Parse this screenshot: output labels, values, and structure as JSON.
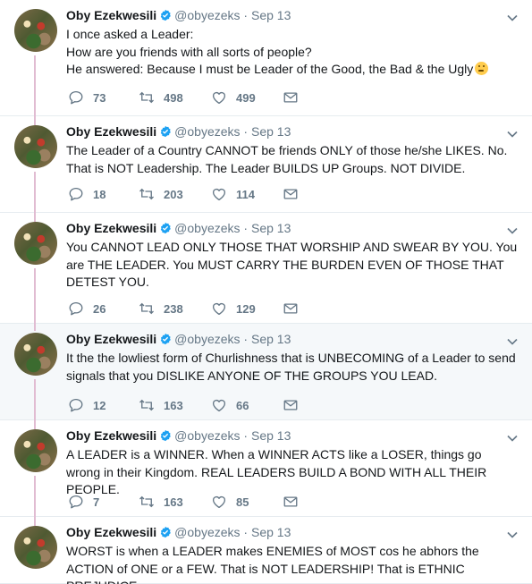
{
  "colors": {
    "verified": "#1da1f2",
    "secondary_text": "#657786",
    "thread_line": "#e1bcd2",
    "highlight_bg": "#f5f8fa"
  },
  "author": {
    "name": "Oby Ezekwesili",
    "handle": "@obyezeks",
    "separator": "·"
  },
  "tweets": [
    {
      "date": "Sep 13",
      "text": "I once asked a Leader:\nHow are you friends with all sorts of people?\nHe answered: Because I must be Leader of the Good, the Bad & the Ugly",
      "emoji": "thinking-face",
      "replies": "73",
      "retweets": "498",
      "likes": "499"
    },
    {
      "date": "Sep 13",
      "text": "The Leader of a Country CANNOT be friends ONLY of those he/she LIKES. No. That is NOT Leadership. The Leader BUILDS UP Groups. NOT DIVIDE.",
      "replies": "18",
      "retweets": "203",
      "likes": "114"
    },
    {
      "date": "Sep 13",
      "text": "You CANNOT LEAD ONLY THOSE THAT WORSHIP AND SWEAR BY YOU. You are THE LEADER. You MUST CARRY THE BURDEN EVEN OF THOSE THAT DETEST YOU.",
      "replies": "26",
      "retweets": "238",
      "likes": "129"
    },
    {
      "date": "Sep 13",
      "text": "It the the lowliest form of Churlishness that is UNBECOMING of a Leader to send signals that you DISLIKE ANYONE OF THE GROUPS YOU LEAD.",
      "replies": "12",
      "retweets": "163",
      "likes": "66"
    },
    {
      "date": "Sep 13",
      "text": "A LEADER is a WINNER. When a WINNER ACTS like a LOSER, things go wrong in their Kingdom. REAL LEADERS BUILD A BOND WITH ALL THEIR PEOPLE.",
      "replies": "7",
      "retweets": "163",
      "likes": "85"
    },
    {
      "date": "Sep 13",
      "text": "WORST is when a LEADER makes ENEMIES of MOST cos he abhors the ACTION of ONE or a FEW. That is NOT LEADERSHIP! That is ETHNIC PREJUDICE."
    }
  ]
}
